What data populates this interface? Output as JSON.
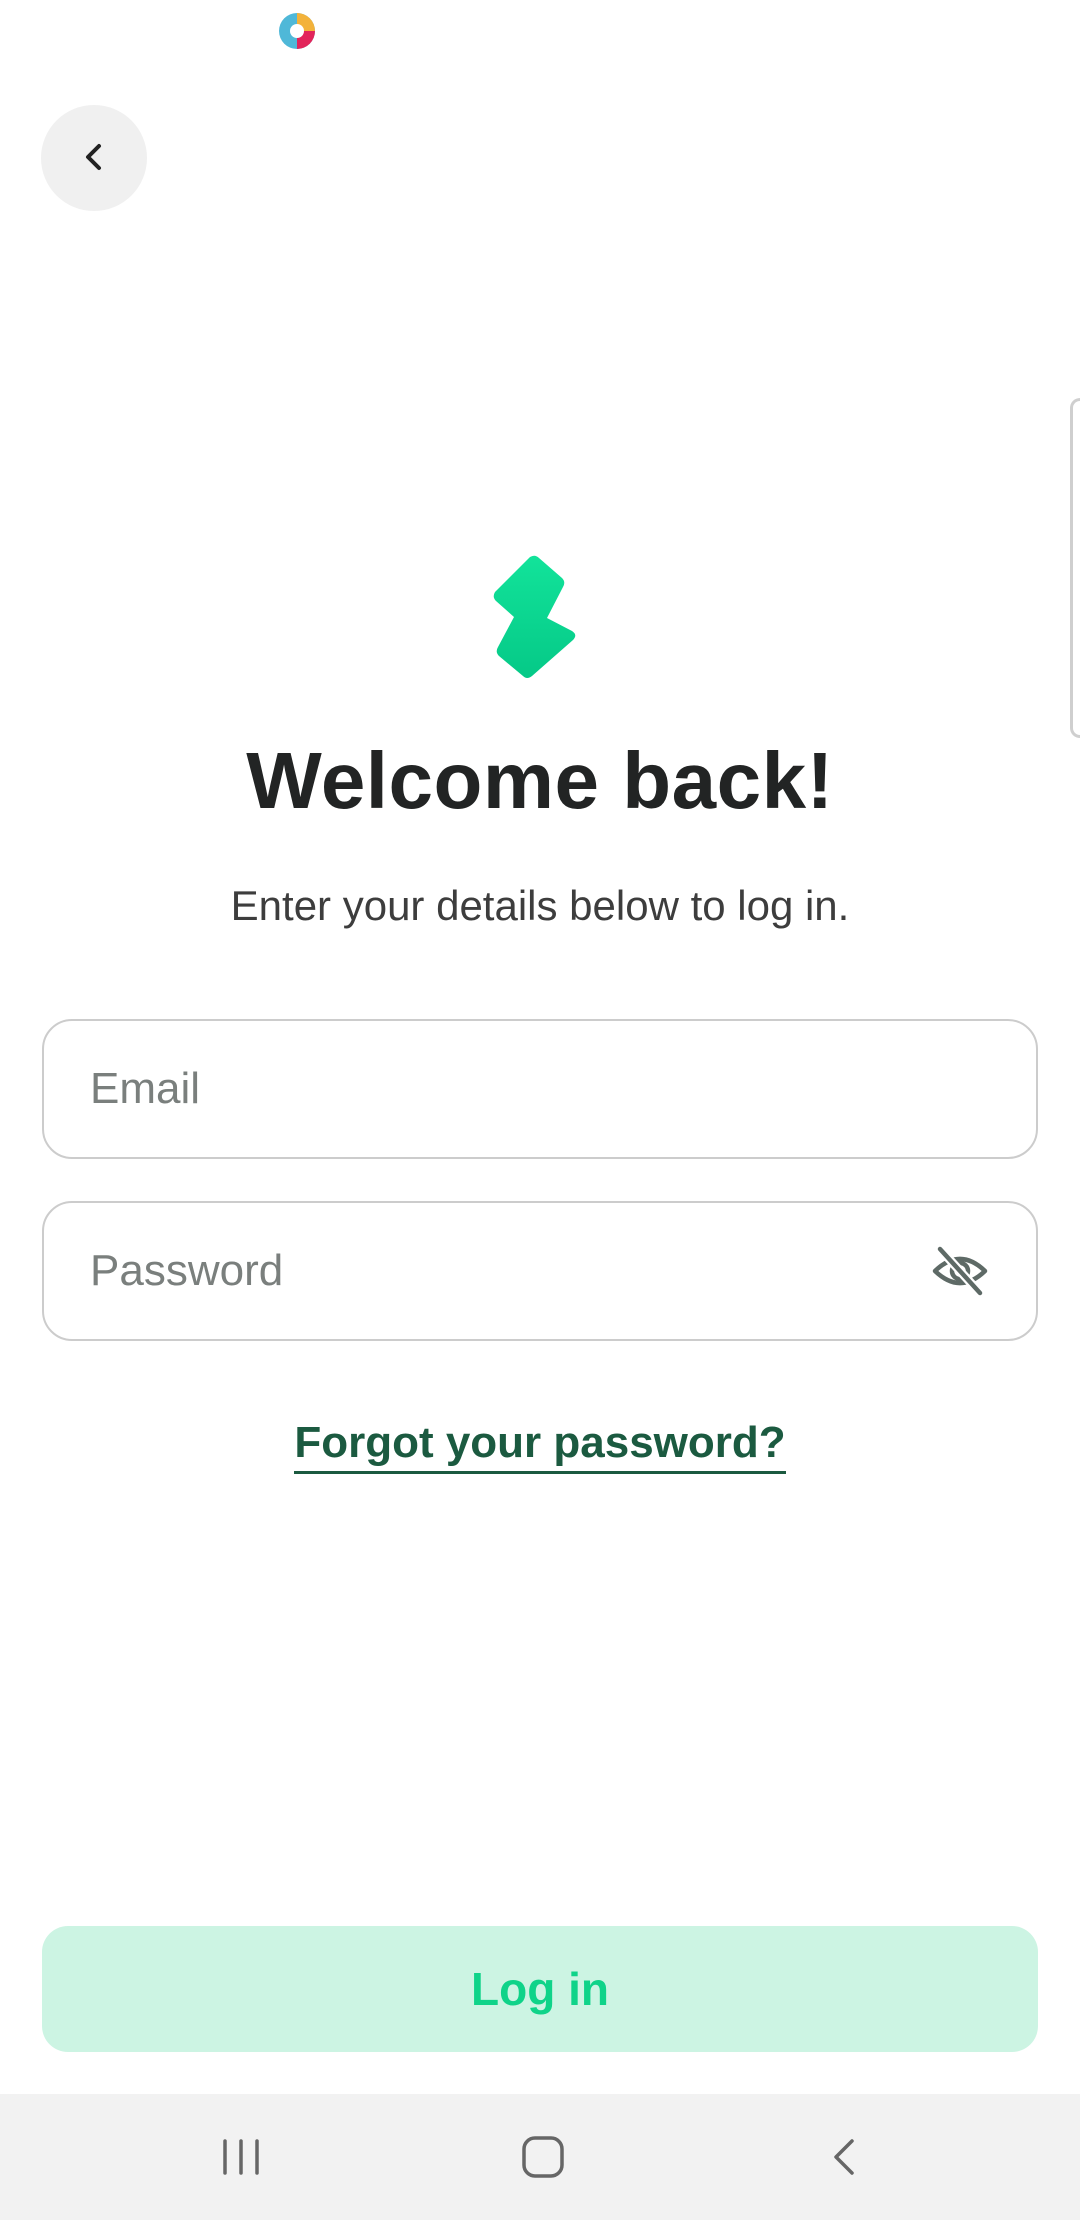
{
  "status_bar": {
    "app_icon": "colorful-circle-icon"
  },
  "header": {
    "back_icon": "chevron-left-icon"
  },
  "brand": {
    "logo_icon": "lightning-bolt-logo-icon",
    "accent_color": "#0fd389"
  },
  "content": {
    "title": "Welcome back!",
    "subtitle": "Enter your details below to log in."
  },
  "form": {
    "email_placeholder": "Email",
    "email_value": "",
    "password_placeholder": "Password",
    "password_value": "",
    "password_toggle_icon": "eye-off-icon"
  },
  "links": {
    "forgot_password": "Forgot your password?"
  },
  "actions": {
    "login_label": "Log in"
  },
  "nav_bar": {
    "recents_icon": "recents-icon",
    "home_icon": "home-icon",
    "back_icon": "back-icon"
  }
}
